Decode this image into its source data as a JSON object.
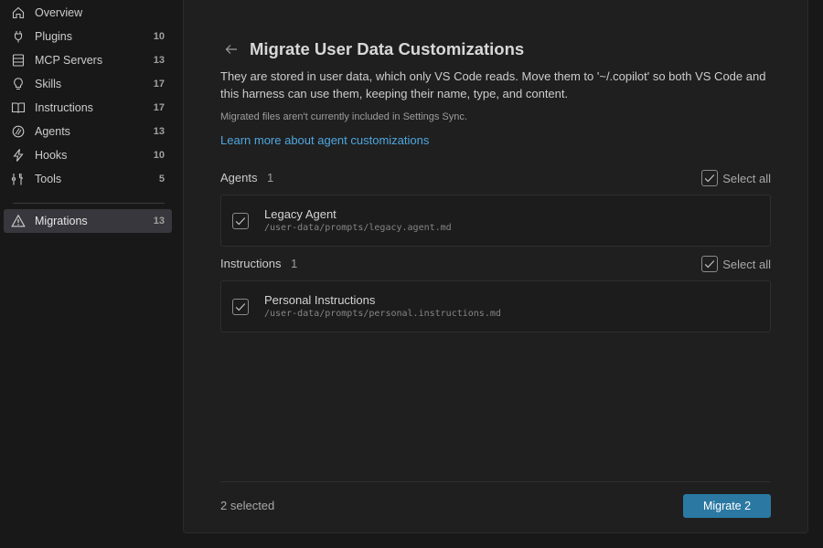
{
  "sidebar": {
    "items": [
      {
        "label": "Overview",
        "count": "",
        "icon": "home-icon"
      },
      {
        "label": "Plugins",
        "count": "10",
        "icon": "plug-icon"
      },
      {
        "label": "MCP Servers",
        "count": "13",
        "icon": "server-icon"
      },
      {
        "label": "Skills",
        "count": "17",
        "icon": "lightbulb-icon"
      },
      {
        "label": "Instructions",
        "count": "17",
        "icon": "book-icon"
      },
      {
        "label": "Agents",
        "count": "13",
        "icon": "agent-icon"
      },
      {
        "label": "Hooks",
        "count": "10",
        "icon": "lightning-icon"
      },
      {
        "label": "Tools",
        "count": "5",
        "icon": "tools-icon"
      }
    ],
    "migrations": {
      "label": "Migrations",
      "count": "13",
      "icon": "warning-icon"
    }
  },
  "main": {
    "title": "Migrate User Data Customizations",
    "description": "They are stored in user data, which only VS Code reads. Move them to '~/.copilot' so both VS Code and this harness can use them, keeping their name, type, and content.",
    "sync_note": "Migrated files aren't currently included in Settings Sync.",
    "learn_link": "Learn more about agent customizations",
    "sections": [
      {
        "name": "Agents",
        "count": "1",
        "select_all": "Select all",
        "items": [
          {
            "name": "Legacy Agent",
            "path": "/user-data/prompts/legacy.agent.md",
            "checked": true
          }
        ]
      },
      {
        "name": "Instructions",
        "count": "1",
        "select_all": "Select all",
        "items": [
          {
            "name": "Personal Instructions",
            "path": "/user-data/prompts/personal.instructions.md",
            "checked": true
          }
        ]
      }
    ],
    "footer": {
      "selected": "2 selected",
      "migrate_label": "Migrate 2"
    }
  },
  "colors": {
    "accent": "#2b79a3",
    "link": "#4fa7e0",
    "background": "#181818",
    "panel": "#1f1f1f"
  }
}
